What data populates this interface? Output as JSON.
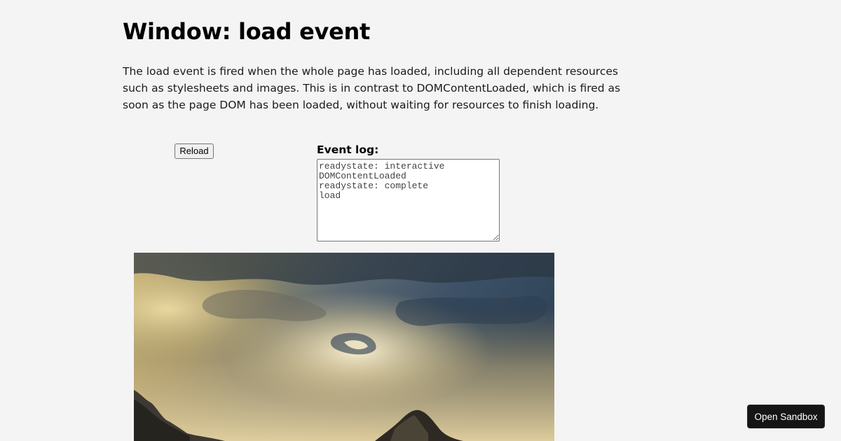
{
  "page": {
    "title": "Window: load event",
    "description": "The load event is fired when the whole page has loaded, including all dependent resources such as stylesheets and images. This is in contrast to DOMContentLoaded, which is fired as soon as the page DOM has been loaded, without waiting for resources to finish loading."
  },
  "controls": {
    "reload_label": "Reload"
  },
  "event_log": {
    "label": "Event log:",
    "value": "readystate: interactive\nDOMContentLoaded\nreadystate: complete\nload\n"
  },
  "image": {
    "icon": "landscape-photo"
  },
  "sandbox": {
    "open_label": "Open Sandbox"
  }
}
